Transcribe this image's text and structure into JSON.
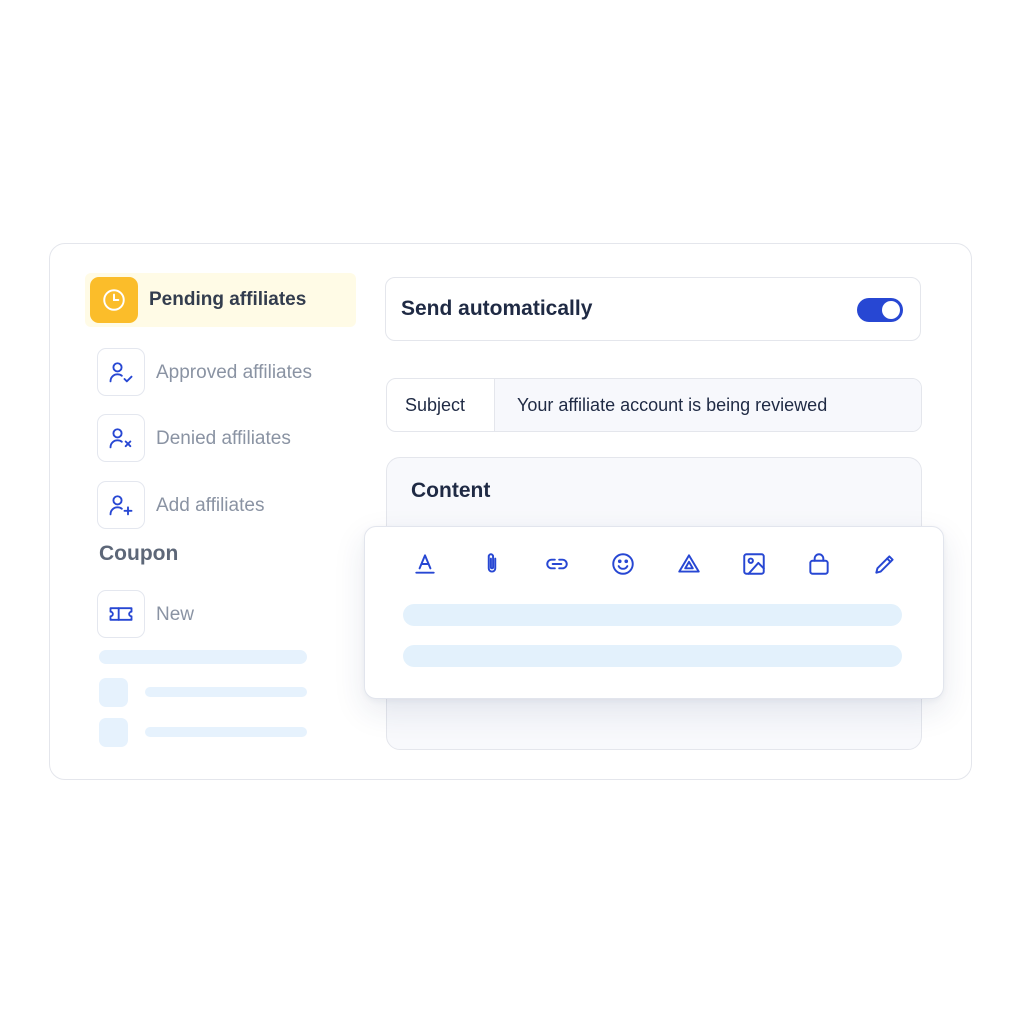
{
  "colors": {
    "accent": "#2747d3",
    "highlight_bg": "#fffbe6",
    "highlight_icon": "#fbbd2a",
    "skeleton": "#e6f2fd"
  },
  "sidebar": {
    "active": {
      "label": "Pending affiliates",
      "icon": "clock-icon"
    },
    "items": [
      {
        "label": "Approved affiliates",
        "icon": "user-check-icon"
      },
      {
        "label": "Denied affiliates",
        "icon": "user-x-icon"
      },
      {
        "label": "Add affiliates",
        "icon": "user-plus-icon"
      }
    ],
    "section_title": "Coupon",
    "coupon_item": {
      "label": "New",
      "icon": "ticket-icon"
    }
  },
  "settings": {
    "send_automatically_label": "Send automatically",
    "send_automatically_on": true
  },
  "email": {
    "subject_label": "Subject",
    "subject_value": "Your affiliate account is being reviewed",
    "content_label": "Content"
  },
  "toolbar": {
    "tools": [
      "text-format-icon",
      "attachment-icon",
      "link-icon",
      "emoji-icon",
      "drive-icon",
      "image-icon",
      "bag-icon",
      "pencil-icon"
    ]
  }
}
